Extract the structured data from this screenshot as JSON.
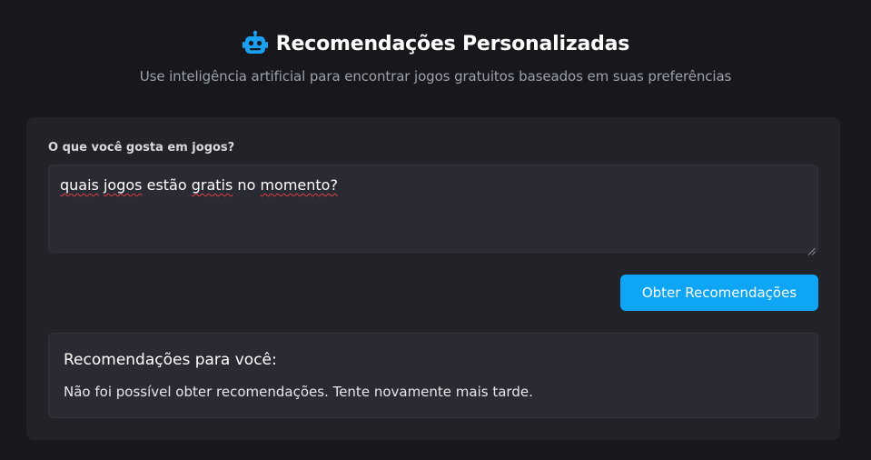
{
  "header": {
    "title": "Recomendações Personalizadas",
    "subtitle": "Use inteligência artificial para encontrar jogos gratuitos baseados em suas preferências",
    "icon": "robot-icon"
  },
  "form": {
    "label": "O que você gosta em jogos?",
    "input_value_words": [
      "quais",
      "jogos",
      "estão",
      "gratis",
      "no",
      "momento?"
    ],
    "submit_label": "Obter Recomendações"
  },
  "result": {
    "title": "Recomendações para você:",
    "message": "Não foi possível obter recomendações. Tente novamente mais tarde."
  },
  "colors": {
    "background": "#18181c",
    "card": "#222229",
    "accent": "#0ea5f5",
    "muted_text": "#9aa1ad"
  }
}
